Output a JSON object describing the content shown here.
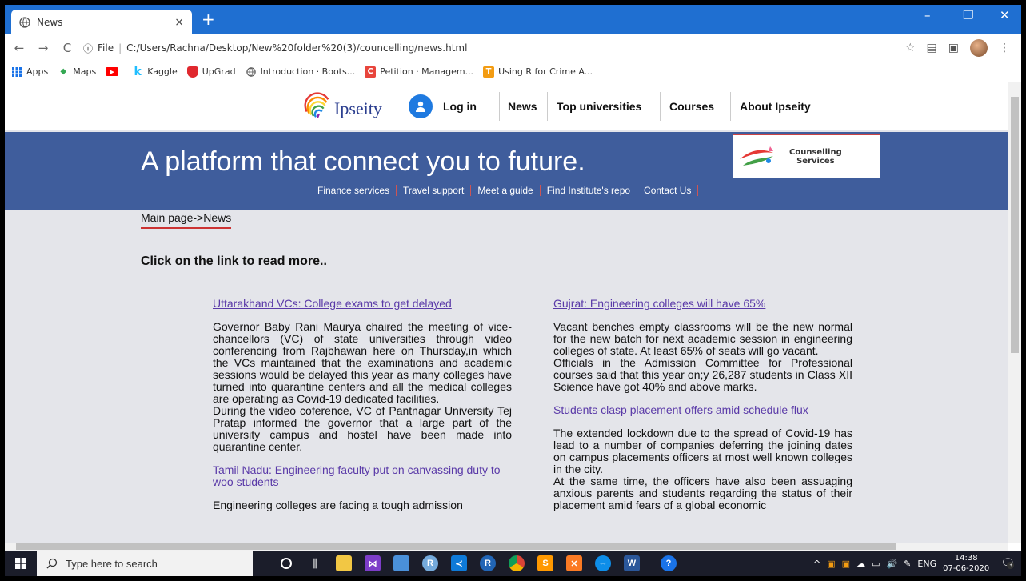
{
  "browser": {
    "tab_title": "News",
    "new_tab": "+",
    "close_tab": "×",
    "window_controls": {
      "minimize": "–",
      "maximize": "❐",
      "close": "✕"
    },
    "url_prefix": "File",
    "url": "C:/Users/Rachna/Desktop/New%20folder%20(3)/councelling/news.html",
    "bookmarks": [
      {
        "label": "Apps",
        "color": "#1a73e8"
      },
      {
        "label": "Maps",
        "color": "#34a853"
      },
      {
        "label": "",
        "color": "#ff0000"
      },
      {
        "label": "Kaggle",
        "color": "#20beff"
      },
      {
        "label": "UpGrad",
        "color": "#e0282e"
      },
      {
        "label": "Introduction · Boots...",
        "color": "#555555"
      },
      {
        "label": "Petition · Managem...",
        "color": "#e8453c"
      },
      {
        "label": "Using R for Crime A...",
        "color": "#f39c12"
      }
    ]
  },
  "site": {
    "logo_name": "Ipseity",
    "nav": [
      "Log in",
      "News",
      "Top universities",
      "Courses",
      "About Ipseity"
    ],
    "tagline": "A platform that connect you to future.",
    "counselling_box": {
      "line1": "Counselling",
      "line2": "Services"
    },
    "services": [
      "Finance services",
      "Travel support",
      "Meet a guide",
      "Find Institute's repo",
      "Contact Us"
    ],
    "breadcrumb": "Main page->News",
    "intro": "Click on the link to read more..",
    "news_left": [
      {
        "title": "Uttarakhand VCs: College exams to get delayed",
        "body": "Governor Baby Rani Maurya chaired the meeting of vice-chancellors (VC) of state universities through video conferencing from Rajbhawan here on Thursday,in which the VCs maintained that the examinations and academic sessions would be delayed this year as many colleges have turned into quarantine centers and all the medical colleges are operating as Covid-19 dedicated facilities.",
        "body2": "During the video coference, VC of Pantnagar University Tej Pratap informed the governor that a large part of the university campus and hostel have been made into quarantine center."
      },
      {
        "title": "Tamil Nadu: Engineering faculty put on canvassing duty to woo students",
        "body": "Engineering colleges are facing a tough admission",
        "body2": ""
      }
    ],
    "news_right": [
      {
        "title": "Gujrat: Engineering colleges will have 65%",
        "body": "Vacant benches empty classrooms will be the new normal for the new batch for next academic session in engineering colleges of state. At least 65% of seats will go vacant.",
        "body2": "Officials in the Admission Committee for Professional courses said that this year on;y 26,287 students in Class XII Science have got 40% and above marks."
      },
      {
        "title": "Students clasp placement offers amid schedule flux",
        "body": "The extended lockdown due to the spread of Covid-19 has lead to a number of companies deferring the joining dates on campus placements officers at most well known colleges in the city.",
        "body2": "At the same time, the officers have also been assuaging anxious parents and students regarding the status of their placement amid fears of a global economic"
      }
    ]
  },
  "taskbar": {
    "search_placeholder": "Type here to search",
    "lang": "ENG",
    "time": "14:38",
    "date": "07-06-2020",
    "notification_count": "3"
  }
}
